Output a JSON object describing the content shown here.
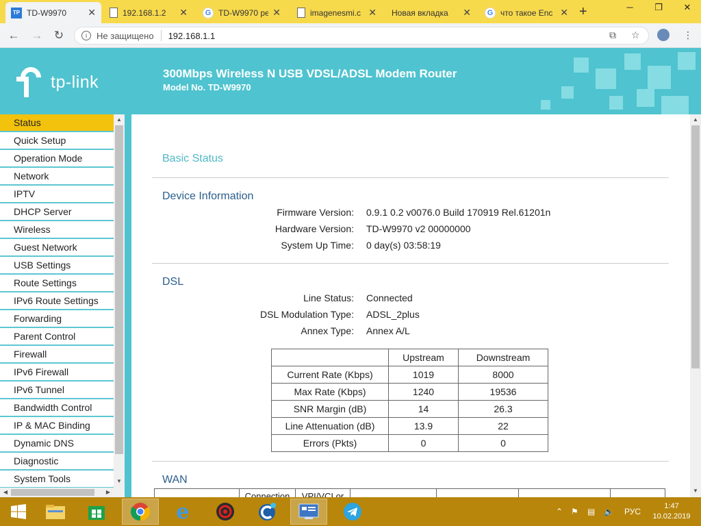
{
  "browser": {
    "tabs": [
      {
        "title": "TD-W9970",
        "favicon": "tp-link-favicon",
        "active": true
      },
      {
        "title": "192.168.1.2",
        "favicon": "document-icon",
        "active": false
      },
      {
        "title": "TD-W9970 pe",
        "favicon": "google-icon",
        "active": false
      },
      {
        "title": "imagenesmi.c",
        "favicon": "document-icon",
        "active": false
      },
      {
        "title": "Новая вкладка",
        "favicon": "none",
        "active": false
      },
      {
        "title": "что такое Enc",
        "favicon": "google-icon",
        "active": false
      }
    ],
    "security_label": "Не защищено",
    "url": "192.168.1.1"
  },
  "banner": {
    "brand": "tp-link",
    "product_title": "300Mbps Wireless N USB VDSL/ADSL Modem Router",
    "model": "Model No. TD-W9970",
    "colors": {
      "banner": "#4fc3cf",
      "active_menu": "#f3c20d",
      "menu_divider": "#5cc7d2"
    }
  },
  "menu": {
    "items": [
      {
        "label": "Status",
        "active": true
      },
      {
        "label": "Quick Setup"
      },
      {
        "label": "Operation Mode"
      },
      {
        "label": "Network"
      },
      {
        "label": "IPTV"
      },
      {
        "label": "DHCP Server"
      },
      {
        "label": "Wireless"
      },
      {
        "label": "Guest Network"
      },
      {
        "label": "USB Settings"
      },
      {
        "label": "Route Settings"
      },
      {
        "label": "IPv6 Route Settings"
      },
      {
        "label": "Forwarding"
      },
      {
        "label": "Parent Control"
      },
      {
        "label": "Firewall"
      },
      {
        "label": "IPv6 Firewall"
      },
      {
        "label": "IPv6 Tunnel"
      },
      {
        "label": "Bandwidth Control"
      },
      {
        "label": "IP & MAC Binding"
      },
      {
        "label": "Dynamic DNS"
      },
      {
        "label": "Diagnostic"
      },
      {
        "label": "System Tools"
      }
    ]
  },
  "status": {
    "page_title": "Basic Status",
    "device": {
      "heading": "Device Information",
      "rows": [
        {
          "label": "Firmware Version:",
          "value": "0.9.1 0.2 v0076.0 Build 170919 Rel.61201n"
        },
        {
          "label": "Hardware Version:",
          "value": "TD-W9970 v2 00000000"
        },
        {
          "label": "System Up Time:",
          "value": "0 day(s) 03:58:19"
        }
      ]
    },
    "dsl": {
      "heading": "DSL",
      "rows": [
        {
          "label": "Line Status:",
          "value": "Connected"
        },
        {
          "label": "DSL Modulation Type:",
          "value": "ADSL_2plus"
        },
        {
          "label": "Annex Type:",
          "value": "Annex A/L"
        }
      ],
      "table": {
        "headers": [
          "",
          "Upstream",
          "Downstream"
        ],
        "rows": [
          [
            "Current Rate (Kbps)",
            "1019",
            "8000"
          ],
          [
            "Max Rate (Kbps)",
            "1240",
            "19536"
          ],
          [
            "SNR Margin (dB)",
            "14",
            "26.3"
          ],
          [
            "Line Attenuation (dB)",
            "13.9",
            "22"
          ],
          [
            "Errors (Pkts)",
            "0",
            "0"
          ]
        ]
      }
    },
    "wan": {
      "heading": "WAN",
      "headers": [
        "",
        "Connection",
        "VPI/VCI or",
        "",
        "",
        "",
        ""
      ]
    }
  },
  "taskbar": {
    "language": "РУС",
    "time": "1:47",
    "date": "10.02.2019"
  }
}
